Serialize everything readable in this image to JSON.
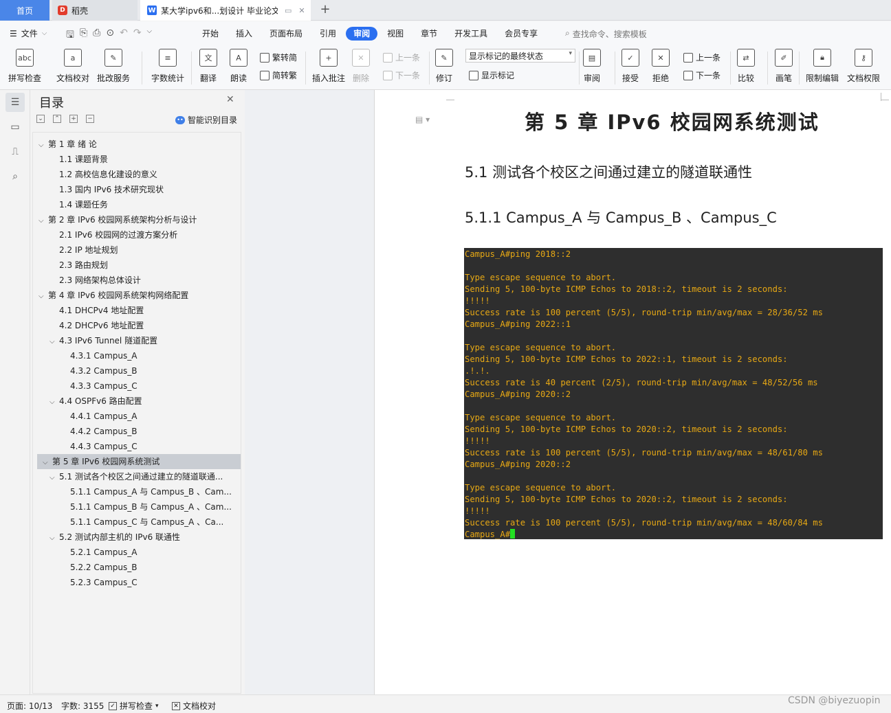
{
  "tabs": {
    "home": "首页",
    "daoke": "稻壳",
    "document": "某大学ipv6和...划设计 毕业论文"
  },
  "menu": {
    "file": "文件",
    "items": [
      "开始",
      "插入",
      "页面布局",
      "引用",
      "审阅",
      "视图",
      "章节",
      "开发工具",
      "会员专享"
    ],
    "active": "审阅",
    "search": "查找命令、搜索模板"
  },
  "ribbon": {
    "spellcheck": "拼写检查",
    "doc_proof": "文档校对",
    "batch_service": "批改服务",
    "word_count": "字数统计",
    "translate": "翻译",
    "read_aloud": "朗读",
    "trad_to_simp": "繁转简",
    "simp_to_trad": "简转繁",
    "insert_comment": "插入批注",
    "delete": "删除",
    "prev_comment": "上一条",
    "next_comment": "下一条",
    "revise": "修订",
    "markup_state": "显示标记的最终状态",
    "show_markup": "显示标记",
    "review": "审阅",
    "accept": "接受",
    "reject": "拒绝",
    "prev_change": "上一条",
    "next_change": "下一条",
    "compare": "比较",
    "pen": "画笔",
    "restrict_edit": "限制编辑",
    "doc_permission": "文档权限"
  },
  "toc": {
    "title": "目录",
    "smart_label": "智能识别目录",
    "items": [
      {
        "level": 1,
        "text": "第 1 章 绪 论",
        "chev": true
      },
      {
        "level": 2,
        "text": "1.1 课题背景",
        "chev": false
      },
      {
        "level": 2,
        "text": "1.2 高校信息化建设的意义",
        "chev": false
      },
      {
        "level": 2,
        "text": "1.3 国内 IPv6 技术研究现状",
        "chev": false
      },
      {
        "level": 2,
        "text": "1.4 课题任务",
        "chev": false
      },
      {
        "level": 1,
        "text": "第 2 章 IPv6 校园网系统架构分析与设计",
        "chev": true
      },
      {
        "level": 2,
        "text": "2.1 IPv6 校园网的过渡方案分析",
        "chev": false
      },
      {
        "level": 2,
        "text": "2.2 IP 地址规划",
        "chev": false
      },
      {
        "level": 2,
        "text": "2.3 路由规划",
        "chev": false
      },
      {
        "level": 2,
        "text": "2.3 网络架构总体设计",
        "chev": false
      },
      {
        "level": 1,
        "text": "第 4 章 IPv6 校园网系统架构网络配置",
        "chev": true
      },
      {
        "level": 2,
        "text": "4.1 DHCPv4 地址配置",
        "chev": false
      },
      {
        "level": 2,
        "text": "4.2 DHCPv6 地址配置",
        "chev": false
      },
      {
        "level": 2,
        "text": "4.3 IPv6 Tunnel 隧道配置",
        "chev": true
      },
      {
        "level": 3,
        "text": "4.3.1 Campus_A",
        "chev": false
      },
      {
        "level": 3,
        "text": "4.3.2 Campus_B",
        "chev": false
      },
      {
        "level": 3,
        "text": "4.3.3 Campus_C",
        "chev": false
      },
      {
        "level": 2,
        "text": "4.4 OSPFv6 路由配置",
        "chev": true
      },
      {
        "level": 3,
        "text": "4.4.1 Campus_A",
        "chev": false
      },
      {
        "level": 3,
        "text": "4.4.2 Campus_B",
        "chev": false
      },
      {
        "level": 3,
        "text": "4.4.3 Campus_C",
        "chev": false
      },
      {
        "level": 1,
        "text": "第 5 章 IPv6 校园网系统测试",
        "chev": true,
        "selected": true
      },
      {
        "level": 2,
        "text": "5.1 测试各个校区之间通过建立的隧道联通...",
        "chev": true
      },
      {
        "level": 3,
        "text": "5.1.1 Campus_A 与 Campus_B 、Cam...",
        "chev": false
      },
      {
        "level": 3,
        "text": "5.1.1 Campus_B 与 Campus_A 、Cam...",
        "chev": false
      },
      {
        "level": 3,
        "text": "5.1.1 Campus_C 与 Campus_A 、Ca...",
        "chev": false
      },
      {
        "level": 2,
        "text": "5.2 测试内部主机的 IPv6 联通性",
        "chev": true
      },
      {
        "level": 3,
        "text": "5.2.1 Campus_A",
        "chev": false
      },
      {
        "level": 3,
        "text": "5.2.2 Campus_B",
        "chev": false
      },
      {
        "level": 3,
        "text": "5.2.3 Campus_C",
        "chev": false
      }
    ]
  },
  "document": {
    "chapter_title": "第 5 章 IPv6 校园网系统测试",
    "section_title": "5.1 测试各个校区之间通过建立的隧道联通性",
    "subsection_title": "5.1.1 Campus_A 与 Campus_B 、Campus_C",
    "terminal_lines": [
      "Campus_A#ping 2018::2",
      "",
      "Type escape sequence to abort.",
      "Sending 5, 100-byte ICMP Echos to 2018::2, timeout is 2 seconds:",
      "!!!!!",
      "Success rate is 100 percent (5/5), round-trip min/avg/max = 28/36/52 ms",
      "Campus_A#ping 2022::1",
      "",
      "Type escape sequence to abort.",
      "Sending 5, 100-byte ICMP Echos to 2022::1, timeout is 2 seconds:",
      ".!.!.",
      "Success rate is 40 percent (2/5), round-trip min/avg/max = 48/52/56 ms",
      "Campus_A#ping 2020::2",
      "",
      "Type escape sequence to abort.",
      "Sending 5, 100-byte ICMP Echos to 2020::2, timeout is 2 seconds:",
      "!!!!!",
      "Success rate is 100 percent (5/5), round-trip min/avg/max = 48/61/80 ms",
      "Campus_A#ping 2020::2",
      "",
      "Type escape sequence to abort.",
      "Sending 5, 100-byte ICMP Echos to 2020::2, timeout is 2 seconds:",
      "!!!!!",
      "Success rate is 100 percent (5/5), round-trip min/avg/max = 48/60/84 ms"
    ],
    "terminal_prompt": "Campus_A#"
  },
  "status": {
    "page": "页面: 10/13",
    "word_count": "字数: 3155",
    "spellcheck": "拼写检查",
    "doc_proof": "文档校对",
    "watermark": "CSDN @biyezuopin"
  },
  "colors": {
    "accent": "#2b6ff0",
    "terminal_bg": "#2e2e2e",
    "terminal_fg": "#e7a814",
    "cursor": "#22e022"
  }
}
